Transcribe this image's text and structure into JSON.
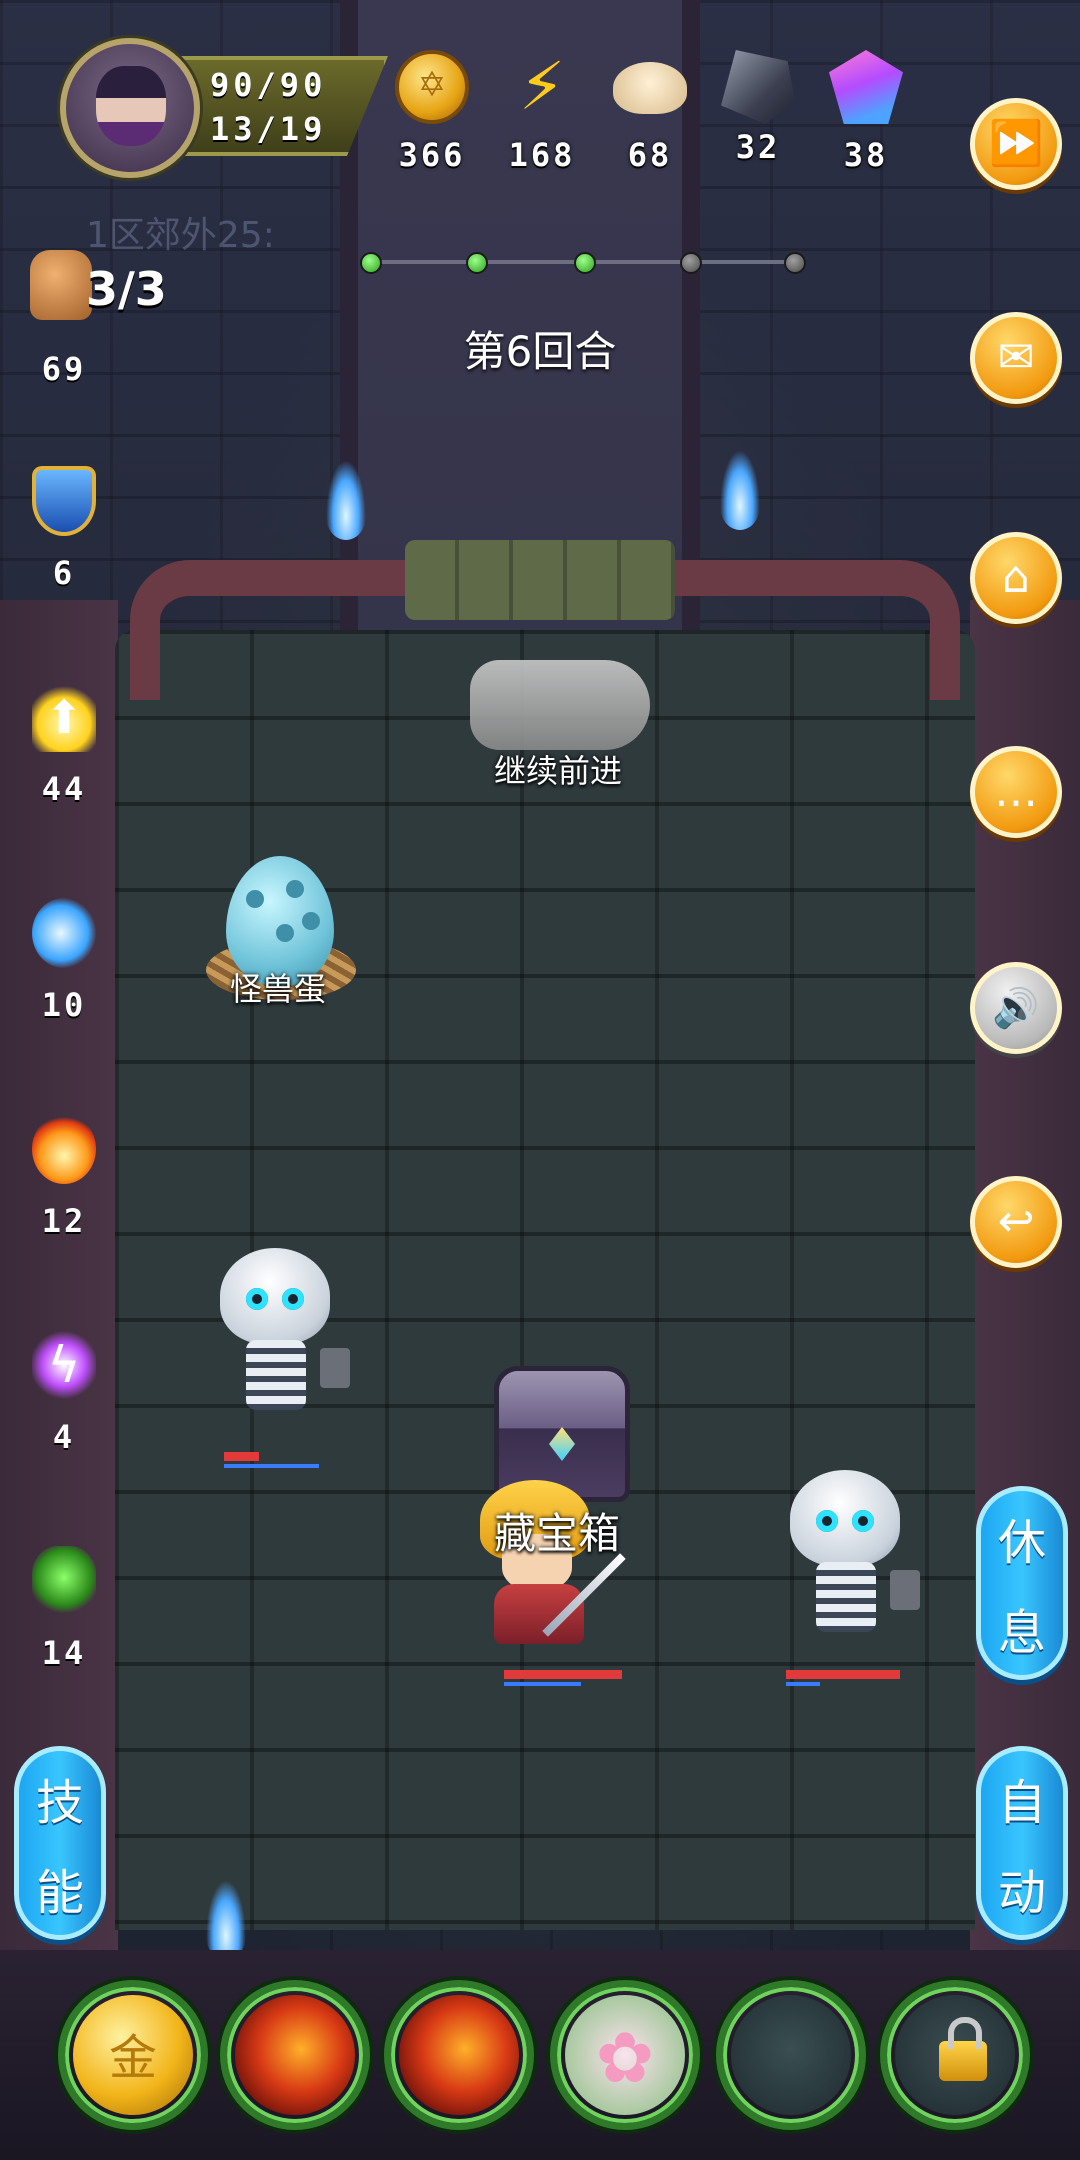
{
  "hero": {
    "hp": "90/90",
    "mp": "13/19"
  },
  "resources": [
    {
      "icon": "gold-coin-icon",
      "value": "366"
    },
    {
      "icon": "lightning-energy-icon",
      "value": "168"
    },
    {
      "icon": "steamed-bun-icon",
      "value": "68"
    },
    {
      "icon": "iron-ore-icon",
      "value": "32"
    },
    {
      "icon": "crystal-gem-icon",
      "value": "38"
    }
  ],
  "location": "1区郊外25:",
  "stage_progress": {
    "total": 5,
    "completed": 3
  },
  "round_label": "第6回合",
  "attack": {
    "icon": "fist-icon",
    "count": "3/3",
    "value": "69"
  },
  "stats": [
    {
      "icon": "shield-icon",
      "value": "6"
    },
    {
      "icon": "holy-arrow-icon",
      "value": "44"
    },
    {
      "icon": "water-wave-icon",
      "value": "10"
    },
    {
      "icon": "fire-icon",
      "value": "12"
    },
    {
      "icon": "lightning-magic-icon",
      "value": "4"
    },
    {
      "icon": "poison-icon",
      "value": "14"
    }
  ],
  "side_buttons": [
    {
      "name": "fast-forward-button",
      "glyph": "⏩"
    },
    {
      "name": "mail-button",
      "glyph": "✉"
    },
    {
      "name": "home-button",
      "glyph": "⌂"
    },
    {
      "name": "chat-button",
      "glyph": "…"
    },
    {
      "name": "sound-button",
      "glyph": "🔊"
    },
    {
      "name": "back-button",
      "glyph": "↩"
    }
  ],
  "rest_label": [
    "休",
    "息"
  ],
  "auto_label": [
    "自",
    "动"
  ],
  "skill_label": [
    "技",
    "能"
  ],
  "field": {
    "continue_label": "继续前进",
    "egg_label": "怪兽蛋",
    "chest_label": "藏宝箱"
  },
  "enemies": [
    {
      "name": "skeleton-enemy-left",
      "hp": 0.35,
      "shield": 0.95
    },
    {
      "name": "skeleton-enemy-right",
      "hp": 1.0,
      "shield": 0.3
    }
  ],
  "player_bars": {
    "hp": 1.0,
    "shield": 0.65
  },
  "skill_slots": [
    {
      "name": "gold-ingot-skill-slot",
      "art": "gold-ingot-icon"
    },
    {
      "name": "fire-demon-skill-slot-1",
      "art": "fire-demon-icon"
    },
    {
      "name": "fire-demon-skill-slot-2",
      "art": "fire-demon-icon"
    },
    {
      "name": "cherry-blossom-skill-slot",
      "art": "cherry-blossom-icon"
    },
    {
      "name": "empty-skill-slot",
      "art": "empty"
    },
    {
      "name": "locked-skill-slot",
      "art": "lock-icon"
    }
  ]
}
